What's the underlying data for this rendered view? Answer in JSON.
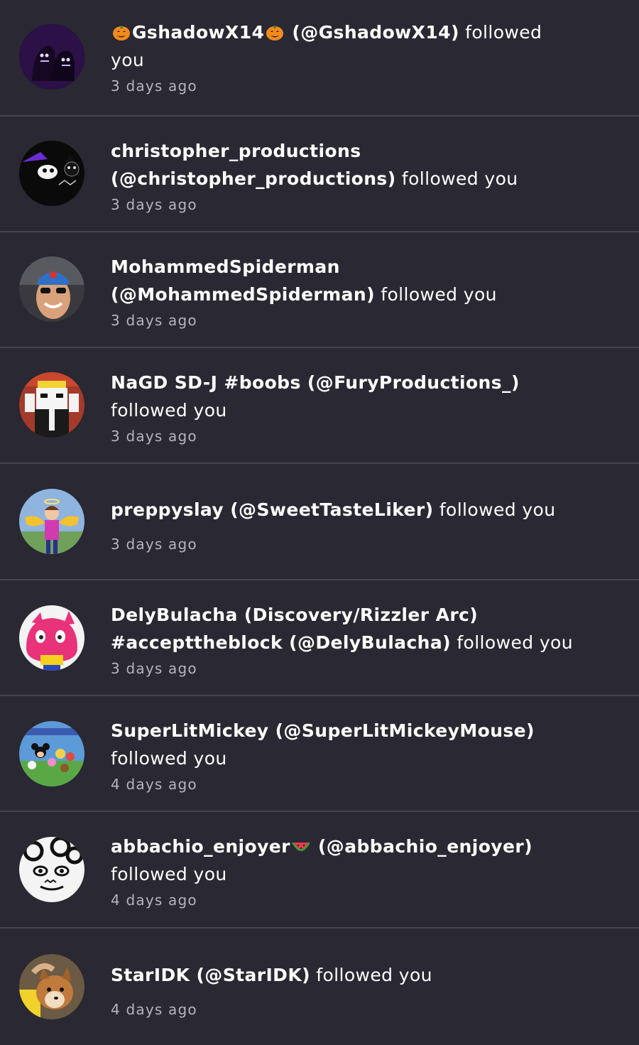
{
  "notifications": [
    {
      "avatar": "shadow-creatures-avatar",
      "lines": [
        {
          "pre_icon": "pumpkin-icon",
          "name": "GshadowX14",
          "post_icon": "pumpkin-icon",
          "name2": " (@GshadowX14)",
          "action": " followed"
        },
        {
          "name": "",
          "action": "you"
        }
      ],
      "time": "3 days ago"
    },
    {
      "avatar": "cartoon-cat-avatar",
      "lines": [
        {
          "name": "christopher_productions",
          "action": ""
        },
        {
          "name": "(@christopher_productions)",
          "action": " followed you"
        }
      ],
      "time": "3 days ago"
    },
    {
      "avatar": "man-sunglasses-avatar",
      "lines": [
        {
          "name": "MohammedSpiderman",
          "action": ""
        },
        {
          "name": "(@MohammedSpiderman)",
          "action": " followed you"
        }
      ],
      "time": "3 days ago"
    },
    {
      "avatar": "pixel-character-avatar",
      "lines": [
        {
          "name": "NaGD SD-J #boobs (@FuryProductions_)",
          "action": ""
        },
        {
          "name": "",
          "action": "followed you"
        }
      ],
      "time": "3 days ago"
    },
    {
      "avatar": "angel-character-avatar",
      "lines": [
        {
          "name": "preppyslay (@SweetTasteLiker)",
          "action": " followed you"
        }
      ],
      "time": "3 days ago"
    },
    {
      "avatar": "pink-cat-avatar",
      "lines": [
        {
          "name": "DelyBulacha (Discovery/Rizzler Arc)",
          "action": ""
        },
        {
          "name": "#accepttheblock (@DelyBulacha)",
          "action": " followed you"
        }
      ],
      "time": "3 days ago"
    },
    {
      "avatar": "mickey-group-avatar",
      "lines": [
        {
          "name": "SuperLitMickey (@SuperLitMickeyMouse)",
          "action": ""
        },
        {
          "name": "",
          "action": "followed you"
        }
      ],
      "time": "4 days ago"
    },
    {
      "avatar": "manga-face-avatar",
      "lines": [
        {
          "name": "abbachio_enjoyer",
          "post_icon": "watermelon-icon",
          "name2": " (@abbachio_enjoyer)",
          "action": ""
        },
        {
          "name": "",
          "action": "followed you"
        }
      ],
      "time": "4 days ago"
    },
    {
      "avatar": "fox-photo-avatar",
      "lines": [
        {
          "name": "StarIDK (@StarIDK)",
          "action": " followed you"
        }
      ],
      "time": "4 days ago"
    }
  ],
  "colors": {
    "background": "#2a2832",
    "divider": "#45434d",
    "text": "#ffffff",
    "time": "#b7b4bf"
  }
}
